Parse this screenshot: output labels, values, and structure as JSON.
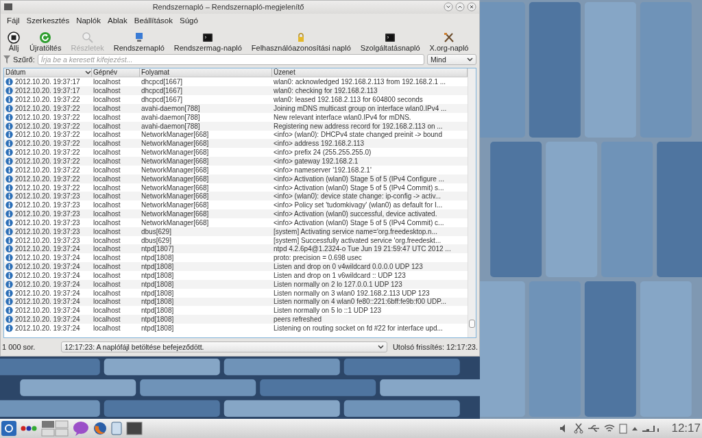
{
  "window": {
    "title": "Rendszernapló – Rendszernapló-megjelenítő"
  },
  "menu": [
    "Fájl",
    "Szerkesztés",
    "Naplók",
    "Ablak",
    "Beállítások",
    "Súgó"
  ],
  "toolbar": [
    {
      "kind": "stop",
      "label": "Állj",
      "disabled": false
    },
    {
      "kind": "reload",
      "label": "Újratöltés",
      "disabled": false
    },
    {
      "kind": "details",
      "label": "Részletek",
      "disabled": true
    },
    {
      "kind": "system",
      "label": "Rendszernapló",
      "disabled": false
    },
    {
      "kind": "terminal",
      "label": "Rendszermag-napló",
      "disabled": false
    },
    {
      "kind": "lock",
      "label": "Felhasználóazonosítási napló",
      "disabled": false
    },
    {
      "kind": "terminal",
      "label": "Szolgáltatásnapló",
      "disabled": false
    },
    {
      "kind": "tools",
      "label": "X.org-napló",
      "disabled": false
    }
  ],
  "filter": {
    "label": "Szűrő:",
    "placeholder": "Írja be a keresett kifejezést...",
    "scope": "Mind"
  },
  "table": {
    "columns": [
      "Dátum",
      "Gépnév",
      "Folyamat",
      "Üzenet"
    ],
    "rows": [
      [
        "2012.10.20. 19:37:17",
        "localhost",
        "dhcpcd[1667]",
        "wlan0: acknowledged 192.168.2.113 from 192.168.2.1 ..."
      ],
      [
        "2012.10.20. 19:37:17",
        "localhost",
        "dhcpcd[1667]",
        "wlan0: checking for 192.168.2.113"
      ],
      [
        "2012.10.20. 19:37:22",
        "localhost",
        "dhcpcd[1667]",
        "wlan0: leased 192.168.2.113 for 604800 seconds"
      ],
      [
        "2012.10.20. 19:37:22",
        "localhost",
        "avahi-daemon[788]",
        "Joining mDNS multicast group on interface wlan0.IPv4 ..."
      ],
      [
        "2012.10.20. 19:37:22",
        "localhost",
        "avahi-daemon[788]",
        "New relevant interface wlan0.IPv4 for mDNS."
      ],
      [
        "2012.10.20. 19:37:22",
        "localhost",
        "avahi-daemon[788]",
        "Registering new address record for 192.168.2.113 on ..."
      ],
      [
        "2012.10.20. 19:37:22",
        "localhost",
        "NetworkManager[668]",
        "<info> (wlan0): DHCPv4 state changed preinit -> bound"
      ],
      [
        "2012.10.20. 19:37:22",
        "localhost",
        "NetworkManager[668]",
        "<info>   address 192.168.2.113"
      ],
      [
        "2012.10.20. 19:37:22",
        "localhost",
        "NetworkManager[668]",
        "<info>   prefix 24 (255.255.255.0)"
      ],
      [
        "2012.10.20. 19:37:22",
        "localhost",
        "NetworkManager[668]",
        "<info>   gateway 192.168.2.1"
      ],
      [
        "2012.10.20. 19:37:22",
        "localhost",
        "NetworkManager[668]",
        "<info>   nameserver '192.168.2.1'"
      ],
      [
        "2012.10.20. 19:37:22",
        "localhost",
        "NetworkManager[668]",
        "<info> Activation (wlan0) Stage 5 of 5 (IPv4 Configure ..."
      ],
      [
        "2012.10.20. 19:37:22",
        "localhost",
        "NetworkManager[668]",
        "<info> Activation (wlan0) Stage 5 of 5 (IPv4 Commit) s..."
      ],
      [
        "2012.10.20. 19:37:23",
        "localhost",
        "NetworkManager[668]",
        "<info> (wlan0): device state change: ip-config -> activ..."
      ],
      [
        "2012.10.20. 19:37:23",
        "localhost",
        "NetworkManager[668]",
        "<info> Policy set 'tudomkivagy' (wlan0) as default for I..."
      ],
      [
        "2012.10.20. 19:37:23",
        "localhost",
        "NetworkManager[668]",
        "<info> Activation (wlan0) successful, device activated."
      ],
      [
        "2012.10.20. 19:37:23",
        "localhost",
        "NetworkManager[668]",
        "<info> Activation (wlan0) Stage 5 of 5 (IPv4 Commit) c..."
      ],
      [
        "2012.10.20. 19:37:23",
        "localhost",
        "dbus[629]",
        "[system] Activating service name='org.freedesktop.n..."
      ],
      [
        "2012.10.20. 19:37:23",
        "localhost",
        "dbus[629]",
        "[system] Successfully activated service 'org.freedeskt..."
      ],
      [
        "2012.10.20. 19:37:24",
        "localhost",
        "ntpd[1807]",
        "ntpd 4.2.6p4@1.2324-o Tue Jun 19 21:59:47 UTC 2012 ..."
      ],
      [
        "2012.10.20. 19:37:24",
        "localhost",
        "ntpd[1808]",
        "proto: precision = 0.698 usec"
      ],
      [
        "2012.10.20. 19:37:24",
        "localhost",
        "ntpd[1808]",
        "Listen and drop on 0 v4wildcard 0.0.0.0 UDP 123"
      ],
      [
        "2012.10.20. 19:37:24",
        "localhost",
        "ntpd[1808]",
        "Listen and drop on 1 v6wildcard :: UDP 123"
      ],
      [
        "2012.10.20. 19:37:24",
        "localhost",
        "ntpd[1808]",
        "Listen normally on 2 lo 127.0.0.1 UDP 123"
      ],
      [
        "2012.10.20. 19:37:24",
        "localhost",
        "ntpd[1808]",
        "Listen normally on 3 wlan0 192.168.2.113 UDP 123"
      ],
      [
        "2012.10.20. 19:37:24",
        "localhost",
        "ntpd[1808]",
        "Listen normally on 4 wlan0 fe80::221:6bff:fe9b:f00 UDP..."
      ],
      [
        "2012.10.20. 19:37:24",
        "localhost",
        "ntpd[1808]",
        "Listen normally on 5 lo ::1 UDP 123"
      ],
      [
        "2012.10.20. 19:37:24",
        "localhost",
        "ntpd[1808]",
        "peers refreshed"
      ],
      [
        "2012.10.20. 19:37:24",
        "localhost",
        "ntpd[1808]",
        "Listening on routing socket on fd #22 for interface upd..."
      ]
    ]
  },
  "status_bar": {
    "count": "1 000 sor.",
    "message": "12:17:23: A naplófájl betöltése befejeződött.",
    "refresh": "Utolsó frissítés: 12:17:23."
  },
  "taskbar": {
    "clock": "12:17"
  }
}
